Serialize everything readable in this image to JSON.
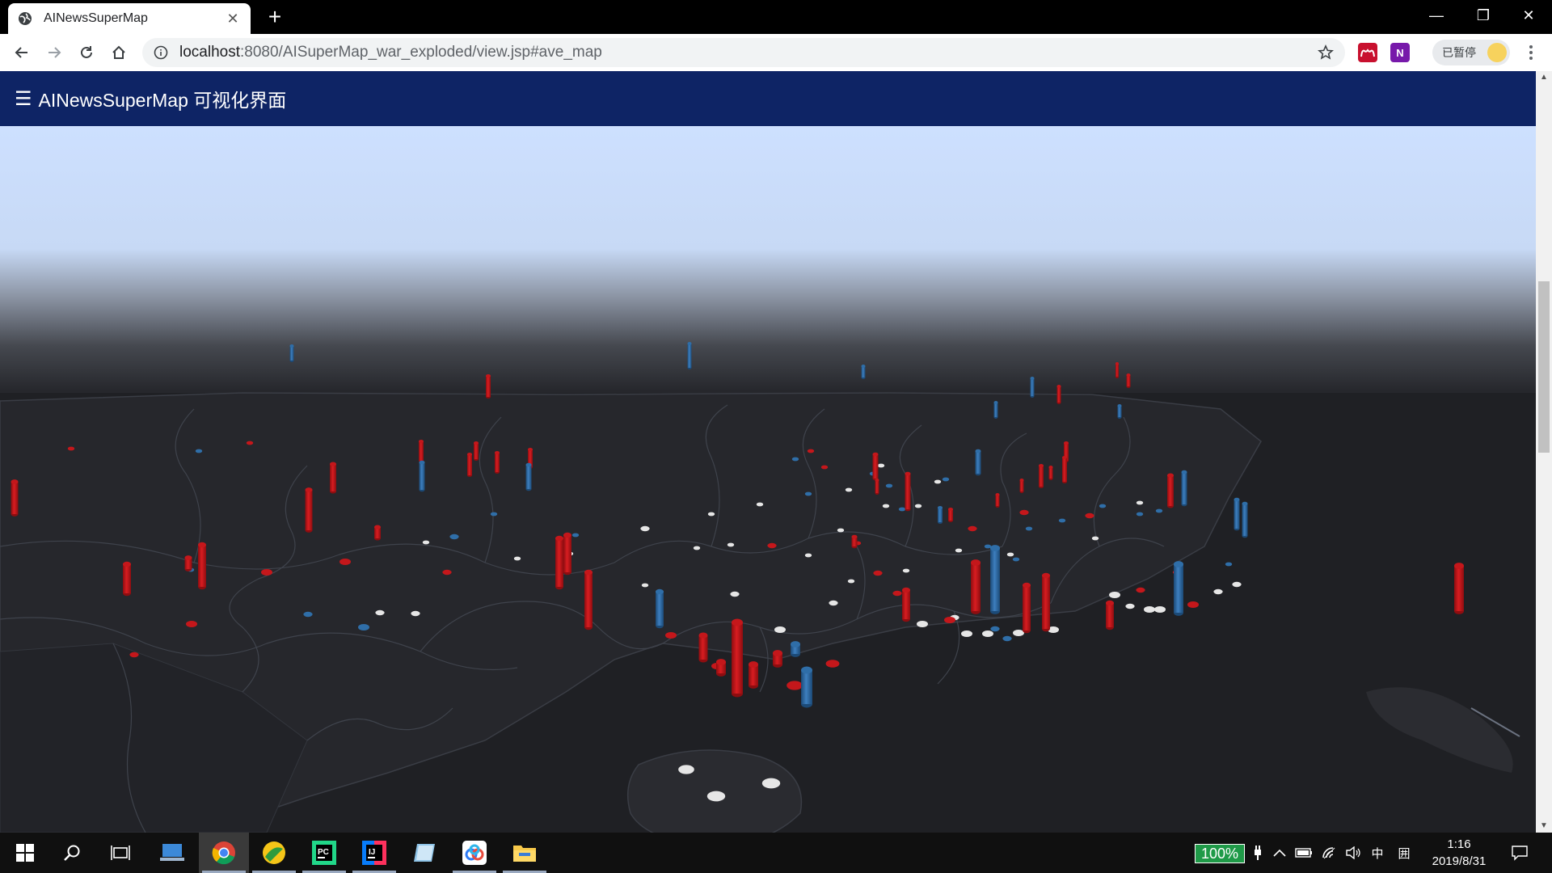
{
  "browser": {
    "tab_title": "AINewsSuperMap",
    "tab_close": "✕",
    "new_tab": "+",
    "url_host": "localhost",
    "url_rest": ":8080/AISuperMap_war_exploded/view.jsp#ave_map",
    "profile_label": "已暂停",
    "window_controls": {
      "minimize": "—",
      "restore": "❐",
      "close": "✕"
    },
    "extensions": [
      {
        "name": "mendeley-extension-icon",
        "color": "#c8102e"
      },
      {
        "name": "onenote-extension-icon",
        "color": "#7719aa",
        "label": "N"
      }
    ]
  },
  "app": {
    "menu_glyph": "☰",
    "title": "AINewsSuperMap 可视化界面"
  },
  "colors": {
    "app_bar": "#0e2465",
    "bar_red": "#c4171b",
    "bar_blue": "#2f6ea8",
    "point_white": "#e6e6e6",
    "ground": "#1f2024",
    "sky": "#cde0ff"
  },
  "taskbar": {
    "apps": [
      "windows-start-icon",
      "search-icon",
      "task-view-icon",
      "laptop-app-icon",
      "chrome-icon",
      "colorful-app-icon",
      "pycharm-icon",
      "intellij-icon",
      "notebook-app-icon",
      "baidu-netdisk-icon",
      "file-explorer-icon"
    ],
    "battery_percent": "100%",
    "ime_lang": "中",
    "ime_mode": "囲",
    "time": "1:16",
    "date": "2019/8/31"
  }
}
